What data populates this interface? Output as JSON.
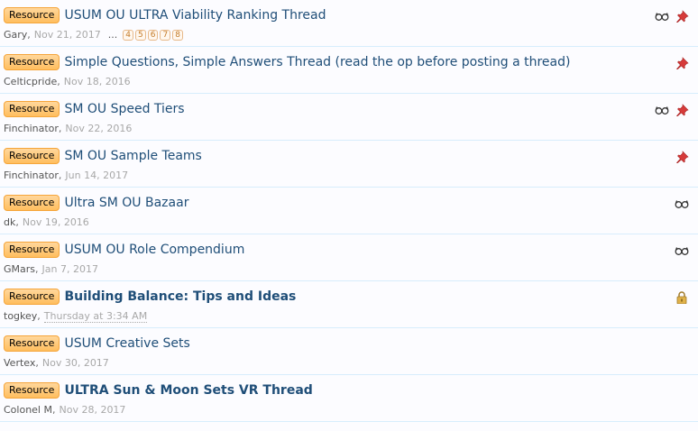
{
  "threads": [
    {
      "prefix": "Resource",
      "title": "USUM OU ULTRA Viability Ranking Thread",
      "author": "Gary",
      "date": "Nov 21, 2017",
      "pages": [
        "4",
        "5",
        "6",
        "7",
        "8"
      ],
      "ellipsis": "...",
      "icons": [
        "watch-icon",
        "pin-icon"
      ]
    },
    {
      "prefix": "Resource",
      "title": "Simple Questions, Simple Answers Thread (read the op before posting a thread)",
      "author": "Celticpride",
      "date": "Nov 18, 2016",
      "icons": [
        "pin-icon"
      ]
    },
    {
      "prefix": "Resource",
      "title": "SM OU Speed Tiers",
      "author": "Finchinator",
      "date": "Nov 22, 2016",
      "icons": [
        "watch-icon",
        "pin-icon"
      ]
    },
    {
      "prefix": "Resource",
      "title": "SM OU Sample Teams",
      "author": "Finchinator",
      "date": "Jun 14, 2017",
      "icons": [
        "pin-icon"
      ]
    },
    {
      "prefix": "Resource",
      "title": "Ultra SM OU Bazaar",
      "author": "dk",
      "date": "Nov 19, 2016",
      "icons": [
        "watch-icon"
      ]
    },
    {
      "prefix": "Resource",
      "title": "USUM OU Role Compendium",
      "author": "GMars",
      "date": "Jan 7, 2017",
      "icons": [
        "watch-icon"
      ]
    },
    {
      "prefix": "Resource",
      "title": "Building Balance: Tips and Ideas",
      "author": "togkey",
      "date": "Thursday at 3:34 AM",
      "unread": true,
      "icons": [
        "lock-icon"
      ]
    },
    {
      "prefix": "Resource",
      "title": "USUM Creative Sets",
      "author": "Vertex",
      "date": "Nov 30, 2017",
      "icons": []
    },
    {
      "prefix": "Resource",
      "title": "ULTRA Sun & Moon Sets VR Thread",
      "author": "Colonel M",
      "date": "Nov 28, 2017",
      "unread": true,
      "icons": []
    }
  ]
}
